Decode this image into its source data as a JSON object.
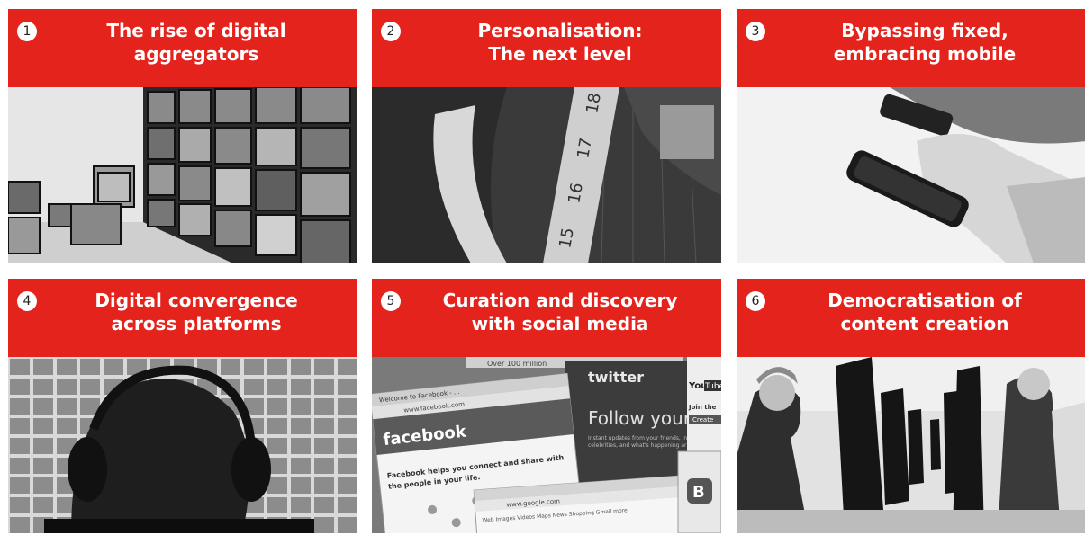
{
  "panels": [
    {
      "number": "1",
      "title": "The rise of digital\naggregators",
      "icon": "video-wall-photo"
    },
    {
      "number": "2",
      "title": "Personalisation:\nThe next level",
      "icon": "tailor-measuring-tape-photo"
    },
    {
      "number": "3",
      "title": "Bypassing fixed,\nembracing mobile",
      "icon": "smartphones-photo"
    },
    {
      "number": "4",
      "title": "Digital convergence\nacross platforms",
      "icon": "headphones-listener-photo"
    },
    {
      "number": "5",
      "title": "Curation and discovery\nwith social media",
      "icon": "social-media-screens-photo"
    },
    {
      "number": "6",
      "title": "Democratisation of\ncontent creation",
      "icon": "office-computers-photo"
    }
  ],
  "screens": {
    "facebook": {
      "logo": "facebook",
      "tagline": "Facebook helps you connect and share with\nthe people in your life.",
      "url": "www.facebook.com",
      "tab": "Welcome to Facebook - ..."
    },
    "twitter": {
      "logo": "twitter",
      "headline": "Follow your in",
      "sub": "Instant updates from your friends, in\ncelebrities, and what's happening ar"
    },
    "google": {
      "url": "www.google.com",
      "nav": "Web  Images  Videos  Maps  News  Shopping  Gmail  more"
    },
    "youtube": {
      "logo_you": "You",
      "logo_tube": "Tube",
      "join": "Join the",
      "create": "Create"
    },
    "topstrip": "Over 100 million"
  },
  "colors": {
    "accent": "#e4231d",
    "text_on_accent": "#ffffff"
  }
}
